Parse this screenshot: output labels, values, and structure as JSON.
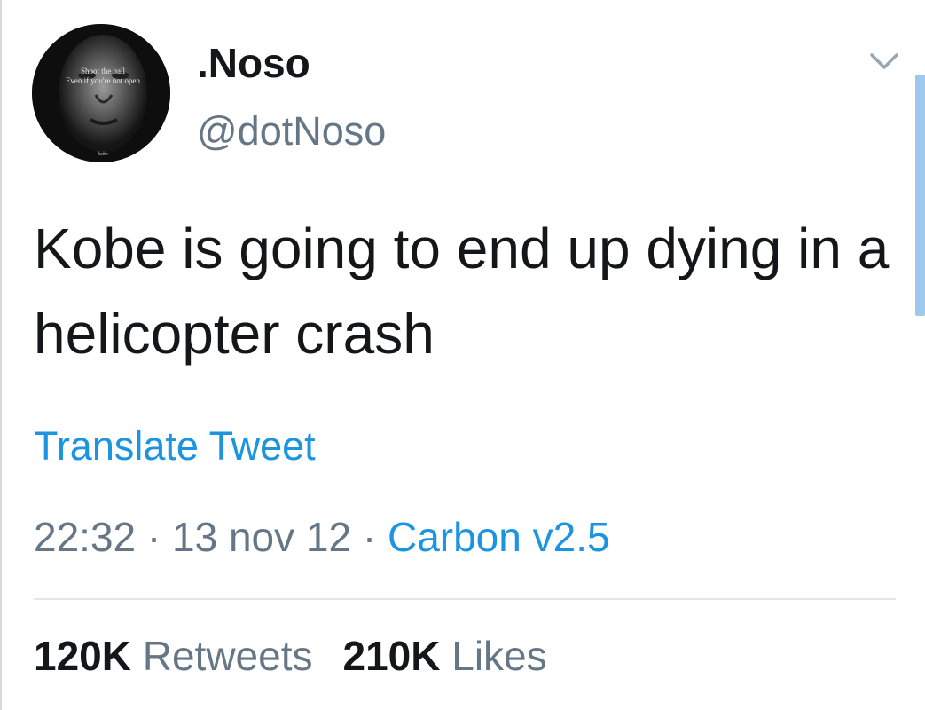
{
  "profile": {
    "display_name": ".Noso",
    "handle": "@dotNoso",
    "avatar_caption_line1": "Shoot the ball",
    "avatar_caption_line2": "Even if you're not open",
    "avatar_signature": "kobe"
  },
  "tweet": {
    "text": "Kobe is going to end up dying in a helicopter crash",
    "translate_label": "Translate Tweet",
    "time": "22:32",
    "date": "13 nov 12",
    "separator": "·",
    "source": "Carbon v2.5"
  },
  "stats": {
    "retweets_count": "120K",
    "retweets_label": "Retweets",
    "likes_count": "210K",
    "likes_label": "Likes"
  },
  "icons": {
    "menu": "chevron-down-icon"
  },
  "colors": {
    "link": "#1b95e0",
    "secondary_text": "#657786",
    "primary_text": "#14171a",
    "divider": "#e1e8ed",
    "scrollbar": "#9fc8ee"
  }
}
